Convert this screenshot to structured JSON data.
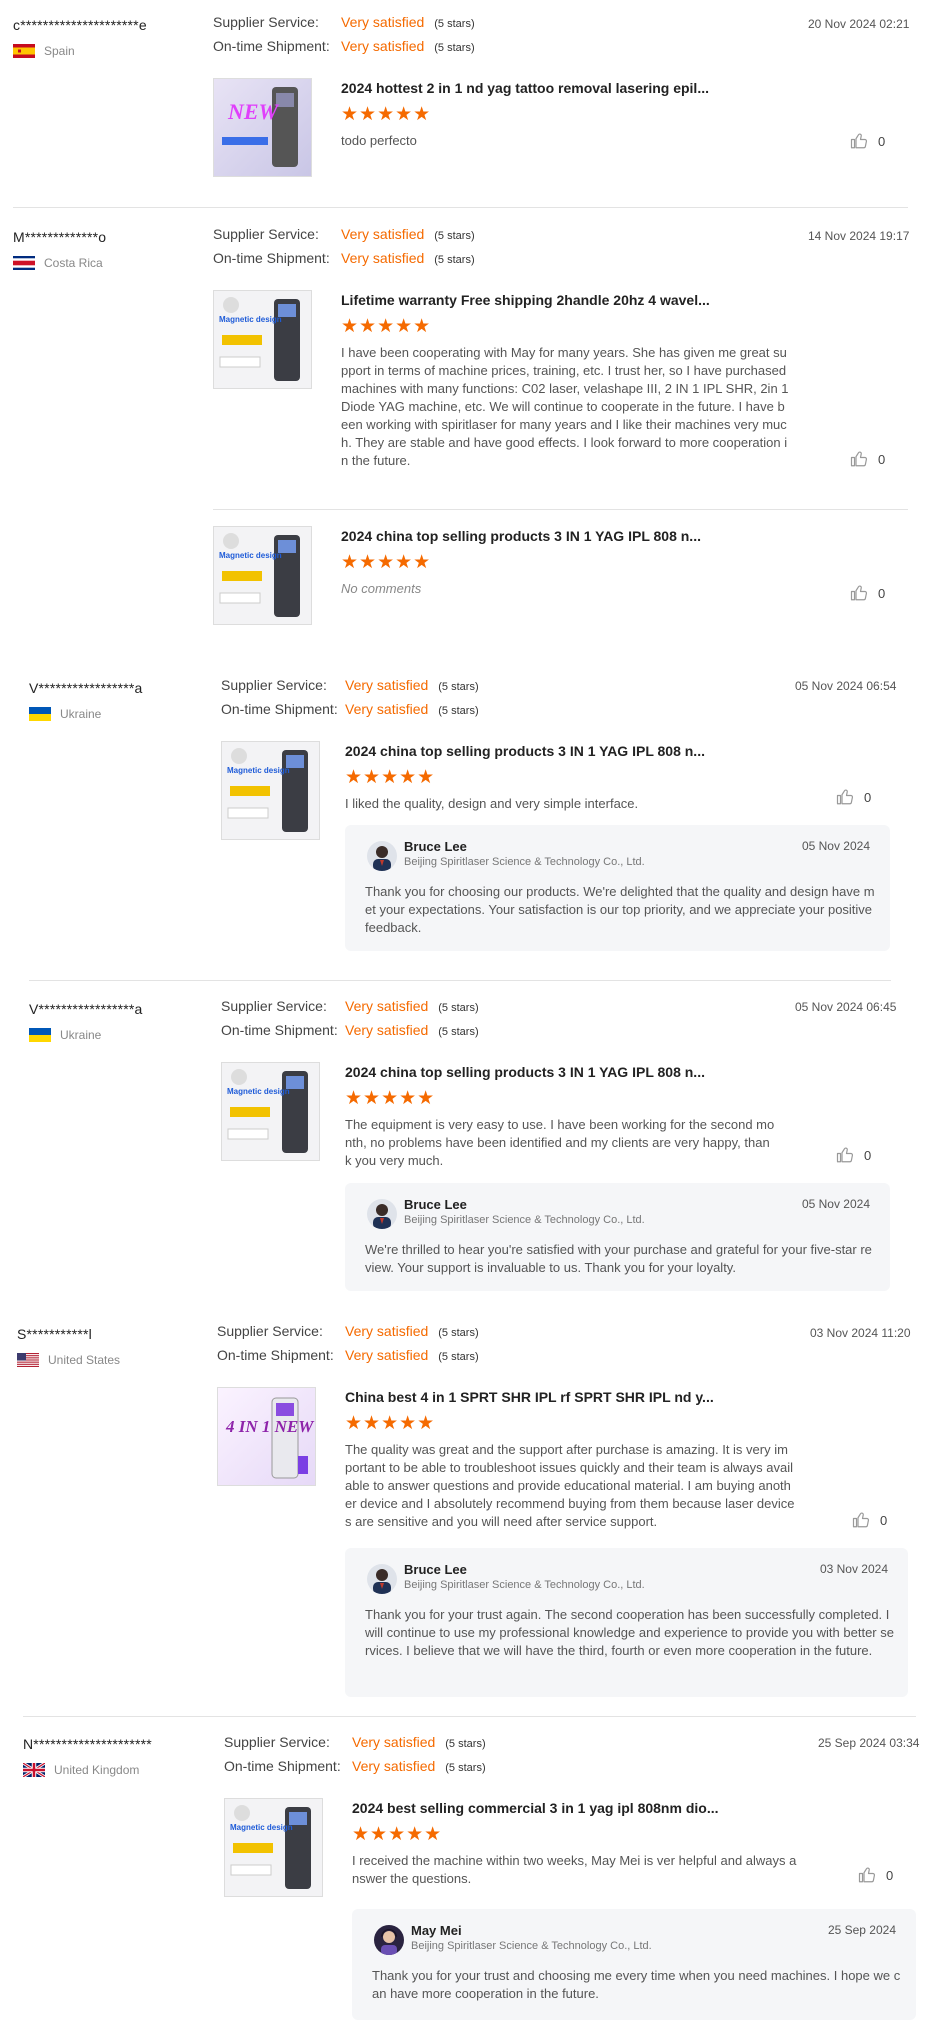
{
  "labels": {
    "supplier_service": "Supplier Service:",
    "ontime_shipment": "On-time Shipment:",
    "very_satisfied": "Very satisfied",
    "five_stars": "(5 stars)",
    "stars_glyph": "★★★★★"
  },
  "reviews": [
    {
      "reviewer": "c*********************e",
      "country": "Spain",
      "date": "20 Nov 2024 02:21",
      "products": [
        {
          "title": "2024 hottest 2 in 1 nd yag tattoo removal lasering epil...",
          "comment": "todo perfecto",
          "likes": "0",
          "thumb_text": "NEW"
        }
      ]
    },
    {
      "reviewer": "M*************o",
      "country": "Costa Rica",
      "date": "14 Nov 2024 19:17",
      "products": [
        {
          "title": "Lifetime warranty Free shipping 2handle 20hz 4 wavel...",
          "comment": "I have been cooperating with May for many years. She has given me great support in terms of machine prices, training, etc. I trust her, so I have purchased machines with many functions: C02 laser, velashape III, 2 IN 1 IPL SHR, 2in 1 Diode YAG machine, etc. We will continue to cooperate in the future.  I have been working with spiritlaser for many years and I like their machines very much. They are stable and have good effects. I look forward to more cooperation in the future.",
          "likes": "0",
          "thumb_text": "Magnetic design"
        },
        {
          "title": "2024 china top selling products 3 IN 1 YAG IPL 808 n...",
          "comment": "No comments",
          "likes": "0",
          "thumb_text": "Magnetic design"
        }
      ]
    },
    {
      "reviewer": "V*****************a",
      "country": "Ukraine",
      "date": "05 Nov 2024 06:54",
      "products": [
        {
          "title": "2024 china top selling products 3 IN 1 YAG IPL 808 n...",
          "comment": "I liked the quality, design and very simple interface.",
          "likes": "0",
          "thumb_text": "Magnetic design"
        }
      ],
      "reply": {
        "name": "Bruce Lee",
        "company": "Beijing Spiritlaser Science & Technology Co., Ltd.",
        "date": "05 Nov 2024",
        "text": "Thank you for choosing our products. We're delighted that the quality and design have met your expectations. Your satisfaction is our top priority, and we appreciate your positive feedback."
      }
    },
    {
      "reviewer": "V*****************a",
      "country": "Ukraine",
      "date": "05 Nov 2024 06:45",
      "products": [
        {
          "title": "2024 china top selling products 3 IN 1 YAG IPL 808 n...",
          "comment": "The equipment is very easy to use. I have been working for the second month, no problems have been identified and my clients are very happy, thank you very much.",
          "likes": "0",
          "thumb_text": "Magnetic design"
        }
      ],
      "reply": {
        "name": "Bruce Lee",
        "company": "Beijing Spiritlaser Science & Technology Co., Ltd.",
        "date": "05 Nov 2024",
        "text": "We're thrilled to hear you're satisfied with your purchase and grateful for your five-star review. Your support is invaluable to us. Thank you for your loyalty."
      }
    },
    {
      "reviewer": "S***********l",
      "country": "United States",
      "date": "03 Nov 2024 11:20",
      "products": [
        {
          "title": "China best 4 in 1 SPRT SHR IPL rf SPRT SHR IPL nd y...",
          "comment": "The quality was great and the support after purchase is amazing. It is very important to be able to troubleshoot issues quickly and their team is always available to answer questions and provide educational material. I am buying another device and I absolutely recommend buying from them because laser devices are sensitive and you will need after service support.",
          "likes": "0",
          "thumb_text": "4 IN 1 NEW"
        }
      ],
      "reply": {
        "name": "Bruce Lee",
        "company": "Beijing Spiritlaser Science & Technology Co., Ltd.",
        "date": "03 Nov 2024",
        "text": "Thank you for your trust again. The second cooperation has been successfully completed. I will continue to use my professional knowledge and experience to provide you with better services. I believe that we will have the third, fourth or even more cooperation in the future."
      }
    },
    {
      "reviewer": "N*********************",
      "country": "United Kingdom",
      "date": "25 Sep 2024 03:34",
      "products": [
        {
          "title": "2024 best selling commercial 3 in 1 yag ipl 808nm dio...",
          "comment": "I received the machine within two weeks, May Mei is ver helpful and always answer the questions.",
          "likes": "0",
          "thumb_text": "Magnetic design"
        }
      ],
      "reply": {
        "name": "May Mei",
        "company": "Beijing Spiritlaser Science & Technology Co., Ltd.",
        "date": "25 Sep 2024",
        "text": "Thank you for your trust and choosing me every time when you need machines. I hope we can have more cooperation in the future."
      }
    }
  ]
}
